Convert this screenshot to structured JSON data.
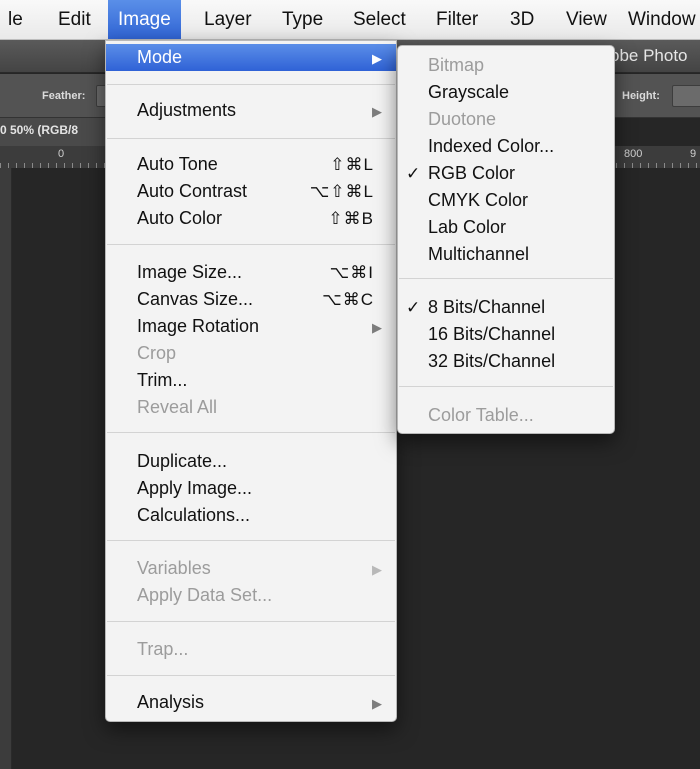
{
  "menubar": {
    "items": [
      "le",
      "Edit",
      "Image",
      "Layer",
      "Type",
      "Select",
      "Filter",
      "3D",
      "View",
      "Window"
    ]
  },
  "app_title": "obe Photo",
  "options_bar": {
    "feather_label": "Feather:",
    "height_label": "Height:"
  },
  "document": {
    "tab_title": "0 50% (RGB/8"
  },
  "ruler": {
    "labels": [
      "0",
      "800",
      "9"
    ]
  },
  "image_menu": {
    "items": [
      {
        "label": "Mode",
        "shortcut": "",
        "submenu": true,
        "enabled": true,
        "highlighted": true
      },
      {
        "label": "Adjustments",
        "shortcut": "",
        "submenu": true,
        "enabled": true
      },
      {
        "label": "Auto Tone",
        "shortcut": "⇧⌘L",
        "enabled": true
      },
      {
        "label": "Auto Contrast",
        "shortcut": "⌥⇧⌘L",
        "enabled": true
      },
      {
        "label": "Auto Color",
        "shortcut": "⇧⌘B",
        "enabled": true
      },
      {
        "label": "Image Size...",
        "shortcut": "⌥⌘I",
        "enabled": true
      },
      {
        "label": "Canvas Size...",
        "shortcut": "⌥⌘C",
        "enabled": true
      },
      {
        "label": "Image Rotation",
        "shortcut": "",
        "submenu": true,
        "enabled": true
      },
      {
        "label": "Crop",
        "shortcut": "",
        "enabled": false
      },
      {
        "label": "Trim...",
        "shortcut": "",
        "enabled": true
      },
      {
        "label": "Reveal All",
        "shortcut": "",
        "enabled": false
      },
      {
        "label": "Duplicate...",
        "shortcut": "",
        "enabled": true
      },
      {
        "label": "Apply Image...",
        "shortcut": "",
        "enabled": true
      },
      {
        "label": "Calculations...",
        "shortcut": "",
        "enabled": true
      },
      {
        "label": "Variables",
        "shortcut": "",
        "submenu": true,
        "enabled": false
      },
      {
        "label": "Apply Data Set...",
        "shortcut": "",
        "enabled": false
      },
      {
        "label": "Trap...",
        "shortcut": "",
        "enabled": false
      },
      {
        "label": "Analysis",
        "shortcut": "",
        "submenu": true,
        "enabled": true
      }
    ]
  },
  "mode_submenu": {
    "items": [
      {
        "label": "Bitmap",
        "checked": false,
        "enabled": false
      },
      {
        "label": "Grayscale",
        "checked": false,
        "enabled": true
      },
      {
        "label": "Duotone",
        "checked": false,
        "enabled": false
      },
      {
        "label": "Indexed Color...",
        "checked": false,
        "enabled": true
      },
      {
        "label": "RGB Color",
        "checked": true,
        "enabled": true
      },
      {
        "label": "CMYK Color",
        "checked": false,
        "enabled": true
      },
      {
        "label": "Lab Color",
        "checked": false,
        "enabled": true
      },
      {
        "label": "Multichannel",
        "checked": false,
        "enabled": true
      },
      {
        "label": "8 Bits/Channel",
        "checked": true,
        "enabled": true
      },
      {
        "label": "16 Bits/Channel",
        "checked": false,
        "enabled": true
      },
      {
        "label": "32 Bits/Channel",
        "checked": false,
        "enabled": true
      },
      {
        "label": "Color Table...",
        "checked": false,
        "enabled": false
      }
    ],
    "check_glyph": "✓"
  },
  "glyphs": {
    "submenu_arrow": "▶"
  },
  "colors": {
    "highlight": "#2f62d6",
    "menu_bg": "#f3f3f3",
    "disabled_text": "#9c9c9c",
    "workspace": "#262626"
  }
}
